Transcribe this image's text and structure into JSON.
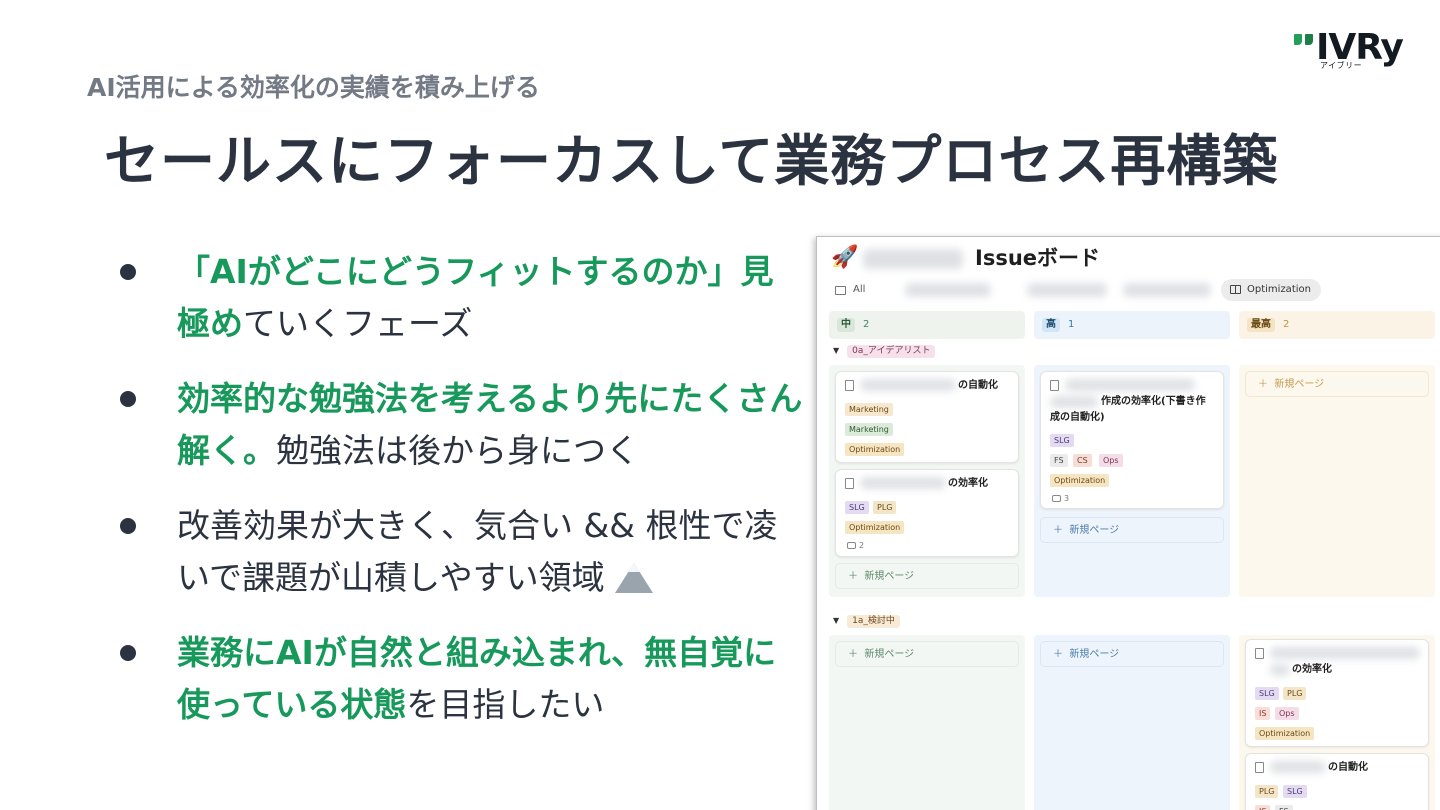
{
  "logo": {
    "wordmark": "IVRy",
    "kana": "アイブリー"
  },
  "header": {
    "subtitle": "AI活用による効率化の実績を積み上げる",
    "title": "セールスにフォーカスして業務プロセス再構築"
  },
  "bullets": [
    {
      "strong": "「AIがどこにどうフィットするのか」見極め",
      "rest": "ていくフェーズ"
    },
    {
      "strong": "効率的な勉強法を考えるより先にたくさん解く。",
      "rest": "勉強法は後から身につく"
    },
    {
      "strong": "",
      "rest": "改善効果が大きく、気合い && 根性で凌いで課題が山積しやすい領域",
      "icon": "mountain-icon"
    },
    {
      "strong": "業務にAIが自然と組み込まれ、無自覚に使っている状態",
      "rest": "を目指したい"
    }
  ],
  "board": {
    "icon": "rocket-icon",
    "title": "Issueボード",
    "views": {
      "all_label": "All",
      "optimization_label": "Optimization"
    },
    "columns": [
      {
        "label": "中",
        "count": "2",
        "color": "#448361"
      },
      {
        "label": "高",
        "count": "1",
        "color": "#337ea9"
      },
      {
        "label": "最高",
        "count": "2",
        "color": "#c29343"
      }
    ],
    "groups": [
      {
        "label": "0a_アイデアリスト"
      },
      {
        "label": "1a_検討中"
      }
    ],
    "cards": {
      "c1": {
        "title": "の自動化",
        "tags": [
          "Marketing",
          "Marketing",
          "Optimization"
        ]
      },
      "c2": {
        "title": "の効率化",
        "tags": [
          "SLG",
          "PLG",
          "Optimization"
        ],
        "comments": "2"
      },
      "c3": {
        "title": "作成の効率化(下書き作成の自動化)",
        "title_line1": "作成の効率化(下書き作",
        "title_line2": "成の自動化)",
        "tags": [
          "SLG",
          "FS",
          "CS",
          "Ops",
          "Optimization"
        ],
        "comments": "3"
      },
      "c4": {
        "title": "の効率化",
        "tags": [
          "SLG",
          "PLG",
          "IS",
          "Ops",
          "Optimization"
        ]
      },
      "c5": {
        "title": "の自動化",
        "tags": [
          "PLG",
          "SLG",
          "IS",
          "FS"
        ]
      }
    },
    "new_page_label": "新規ページ"
  }
}
